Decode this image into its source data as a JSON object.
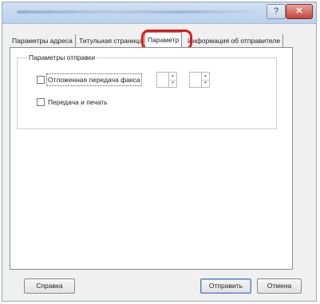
{
  "window": {
    "help_label": "?",
    "close_label": "✕"
  },
  "tabs": [
    {
      "label": "Параметры адреса",
      "active": false
    },
    {
      "label": "Титульная страница",
      "active": false
    },
    {
      "label": "Параметр",
      "active": true
    },
    {
      "label": "Информация об отправителе",
      "active": false
    }
  ],
  "group": {
    "title": "Параметры отправки",
    "delayed_fax": {
      "label": "Отложенная передача факса",
      "checked": false
    },
    "send_and_print": {
      "label": "Передача и печать",
      "checked": false
    },
    "spinner_hour": {
      "value": ""
    },
    "spinner_minute": {
      "value": ""
    }
  },
  "buttons": {
    "help": "Справка",
    "send": "Отправить",
    "cancel": "Отмена"
  },
  "colors": {
    "highlight": "#e01818",
    "close": "#c3463a"
  }
}
